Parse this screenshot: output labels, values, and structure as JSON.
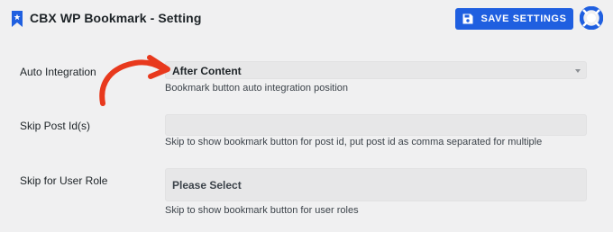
{
  "header": {
    "title": "CBX WP Bookmark - Setting",
    "save_label": "SAVE SETTINGS",
    "accent_color": "#1f5fe0"
  },
  "fields": {
    "auto_integration": {
      "label": "Auto Integration",
      "value": "After Content",
      "help": "Bookmark button auto integration position"
    },
    "skip_post_ids": {
      "label": "Skip Post Id(s)",
      "value": "",
      "help": "Skip to show bookmark button for post id, put post id as comma separated for multiple"
    },
    "skip_user_role": {
      "label": "Skip for User Role",
      "placeholder": "Please Select",
      "help": "Skip to show bookmark button for user roles"
    }
  },
  "annotation": {
    "arrow_color": "#e8391d"
  },
  "icons": [
    "bookmark-icon",
    "floppy-disk-icon",
    "lifebuoy-icon",
    "caret-down-icon",
    "annotation-arrow-icon"
  ]
}
